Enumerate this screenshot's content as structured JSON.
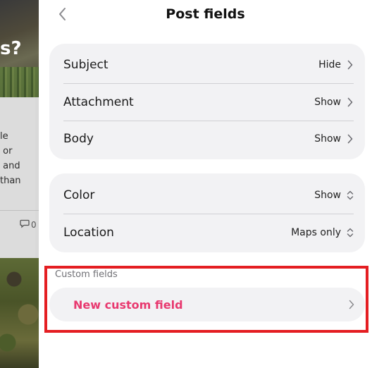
{
  "background": {
    "title_fragment": "s?",
    "card_text_lines": [
      "le",
      " or",
      " and",
      "than"
    ],
    "comment_count": "0"
  },
  "header": {
    "title": "Post fields"
  },
  "field_groups": [
    {
      "rows": [
        {
          "label": "Subject",
          "value": "Hide",
          "icon": "chevron-right-icon"
        },
        {
          "label": "Attachment",
          "value": "Show",
          "icon": "chevron-right-icon"
        },
        {
          "label": "Body",
          "value": "Show",
          "icon": "chevron-right-icon"
        }
      ]
    },
    {
      "rows": [
        {
          "label": "Color",
          "value": "Show",
          "icon": "chevron-up-down-icon"
        },
        {
          "label": "Location",
          "value": "Maps only",
          "icon": "chevron-up-down-icon"
        }
      ]
    }
  ],
  "custom_fields": {
    "section_label": "Custom fields",
    "new_field_label": "New custom field"
  },
  "colors": {
    "accent": "#e8396f",
    "highlight": "#e41e22",
    "group_background": "#f2f2f4"
  }
}
